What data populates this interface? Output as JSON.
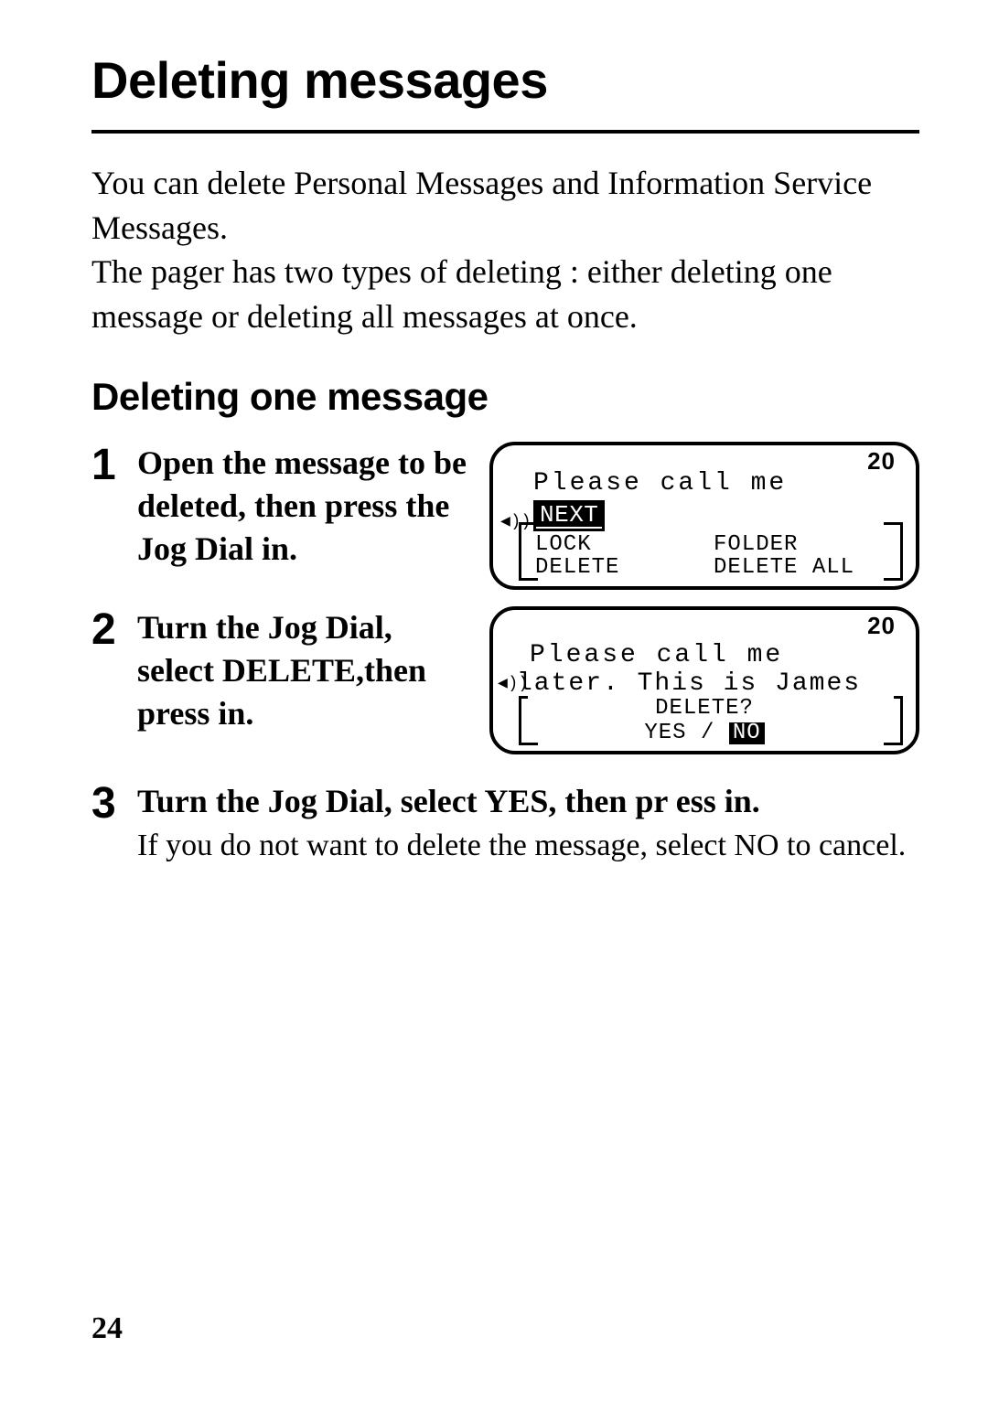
{
  "title": "Deleting messages",
  "intro": "You can delete Personal Messages and Information Service Messages.\nThe pager has two types of deleting : either deleting one message or deleting all messages at once.",
  "subhead": "Deleting one message",
  "steps": [
    {
      "num": "1",
      "text": "Open the message to be deleted, then press the Jog Dial in."
    },
    {
      "num": "2",
      "text": "Turn the Jog Dial, select  DELETE,then press in."
    },
    {
      "num": "3",
      "text": "Turn the Jog Dial, select YES, then pr ess in.",
      "sub": "If you do not want to delete the message, select NO to cancel."
    }
  ],
  "lcd1": {
    "count": "20",
    "message": "Please call me",
    "menu": {
      "next": "NEXT",
      "lock": "LOCK",
      "folder": "FOLDER",
      "delete": "DELETE",
      "delete_all": "DELETE ALL"
    }
  },
  "lcd2": {
    "count": "20",
    "line1": "Please call me",
    "line2": "later. This is James",
    "question": "DELETE?",
    "yes": "YES",
    "sep": " / ",
    "no": "NO"
  },
  "page_number": "24"
}
